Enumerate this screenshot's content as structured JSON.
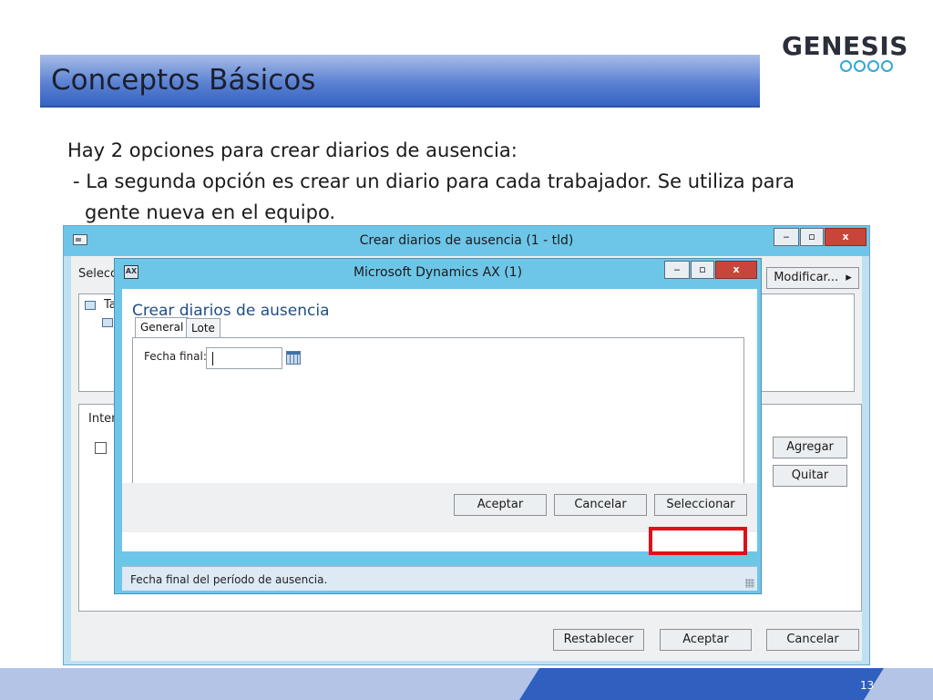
{
  "slide": {
    "title": "Conceptos Básicos",
    "body_lines": [
      "Hay 2 opciones para crear diarios de ausencia:",
      "- La segunda opción es crear un diario para cada trabajador. Se utiliza para",
      "gente nueva en el equipo."
    ],
    "logo_text": "GENESIS",
    "page_number": "13"
  },
  "main_window": {
    "title": "Crear diarios de ausencia (1 - tld)",
    "controls": {
      "minimize": "‒",
      "maximize": "▫",
      "close": "x"
    },
    "left_label_1": "Selecci",
    "tree_label": "Ta",
    "left_label_2": "Interv",
    "buttons": {
      "modify": "Modificar...",
      "modify_arrow": "▸",
      "add": "Agregar",
      "remove": "Quitar",
      "reset": "Restablecer",
      "accept": "Aceptar",
      "cancel": "Cancelar"
    }
  },
  "dialog": {
    "title": "Microsoft Dynamics AX (1)",
    "icon_text": "AX",
    "heading": "Crear diarios de ausencia",
    "tabs": [
      "General",
      "Lote"
    ],
    "field_label": "Fecha final:",
    "field_value": "",
    "buttons": {
      "accept": "Aceptar",
      "cancel": "Cancelar",
      "select": "Seleccionar"
    },
    "status_text": "Fecha final del período de ausencia."
  },
  "colors": {
    "highlight": "#e0101a",
    "title_blue": "#3563c3",
    "window_titlebar": "#6dc6e8"
  }
}
